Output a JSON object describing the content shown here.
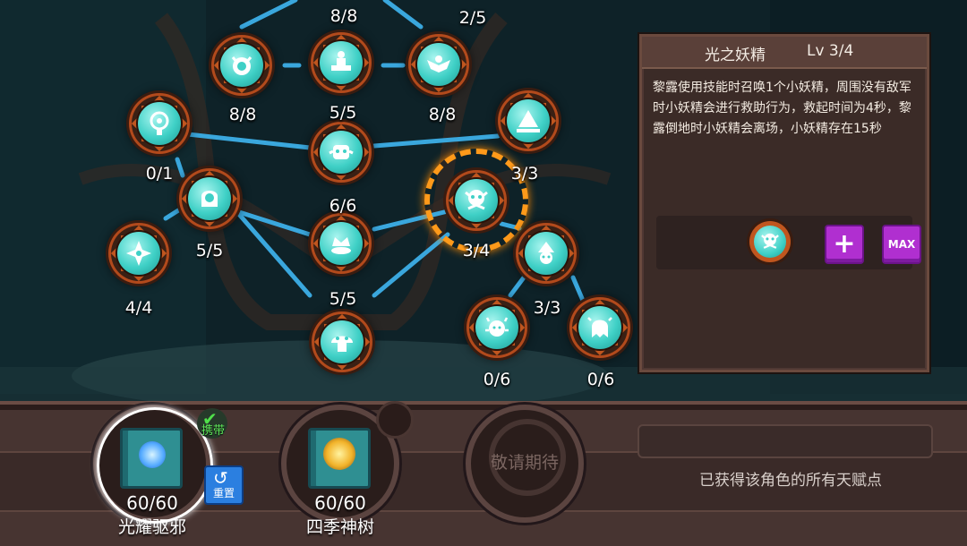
{
  "talent_tree": {
    "levels": [
      "8/8",
      "2/5",
      "8/8",
      "5/5",
      "8/8",
      "0/1",
      "6/6",
      "3/3",
      "5/5",
      "5/5",
      "3/4",
      "4/4",
      "3/3",
      "0/6",
      "0/6"
    ],
    "icons": [
      "horned-helmet-icon",
      "fountain-icon",
      "eagle-icon",
      "spiral-eye-icon",
      "robot-face-icon",
      "triangle-shrine-icon",
      "hooded-figure-icon",
      "crown-sun-icon",
      "ghost-fairy-icon",
      "compass-star-icon",
      "forest-sprite-icon",
      "mushroom-icon",
      "sparkle-sprite-icon",
      "sparkle-ghost-icon"
    ]
  },
  "info_panel": {
    "name": "光之妖精",
    "level": "Lv 3/4",
    "description": "黎露使用技能时召唤1个小妖精，周围没有敌军时小妖精会进行救助行为，救起时间为4秒，黎露倒地时小妖精会离场，小妖精存在15秒",
    "plus_label": "+",
    "max_label": "MAX"
  },
  "books": [
    {
      "count": "60/60",
      "name": "光耀驱邪",
      "carry_label": "携带",
      "reset_label": "重置"
    },
    {
      "count": "60/60",
      "name": "四季神树"
    }
  ],
  "locked_slot": {
    "label": "敬请期待"
  },
  "obtained_note": "已获得该角色的所有天赋点",
  "colors": {
    "node_face": "#3fd0c6",
    "node_frame": "#c0561f",
    "link": "#3aa7dd",
    "panel_bg": "#3b2b27",
    "button_purple": "#b02fd0",
    "selection": "#ff9a1a"
  }
}
